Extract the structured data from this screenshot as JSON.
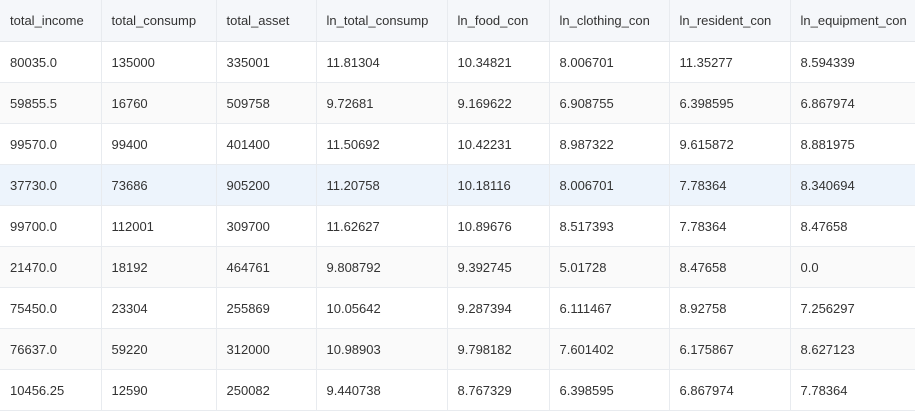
{
  "table": {
    "columns": [
      "total_income",
      "total_consump",
      "total_asset",
      "ln_total_consump",
      "ln_food_con",
      "ln_clothing_con",
      "ln_resident_con",
      "ln_equipment_con"
    ],
    "rows": [
      [
        "80035.0",
        "135000",
        "335001",
        "11.81304",
        "10.34821",
        "8.006701",
        "11.35277",
        "8.594339"
      ],
      [
        "59855.5",
        "16760",
        "509758",
        "9.72681",
        "9.169622",
        "6.908755",
        "6.398595",
        "6.867974"
      ],
      [
        "99570.0",
        "99400",
        "401400",
        "11.50692",
        "10.42231",
        "8.987322",
        "9.615872",
        "8.881975"
      ],
      [
        "37730.0",
        "73686",
        "905200",
        "11.20758",
        "10.18116",
        "8.006701",
        "7.78364",
        "8.340694"
      ],
      [
        "99700.0",
        "112001",
        "309700",
        "11.62627",
        "10.89676",
        "8.517393",
        "7.78364",
        "8.47658"
      ],
      [
        "21470.0",
        "18192",
        "464761",
        "9.808792",
        "9.392745",
        "5.01728",
        "8.47658",
        "0.0"
      ],
      [
        "75450.0",
        "23304",
        "255869",
        "10.05642",
        "9.287394",
        "6.111467",
        "8.92758",
        "7.256297"
      ],
      [
        "76637.0",
        "59220",
        "312000",
        "10.98903",
        "9.798182",
        "7.601402",
        "6.175867",
        "8.627123"
      ],
      [
        "10456.25",
        "12590",
        "250082",
        "9.440738",
        "8.767329",
        "6.398595",
        "6.867974",
        "7.78364"
      ]
    ],
    "highlighted_row": 3
  }
}
